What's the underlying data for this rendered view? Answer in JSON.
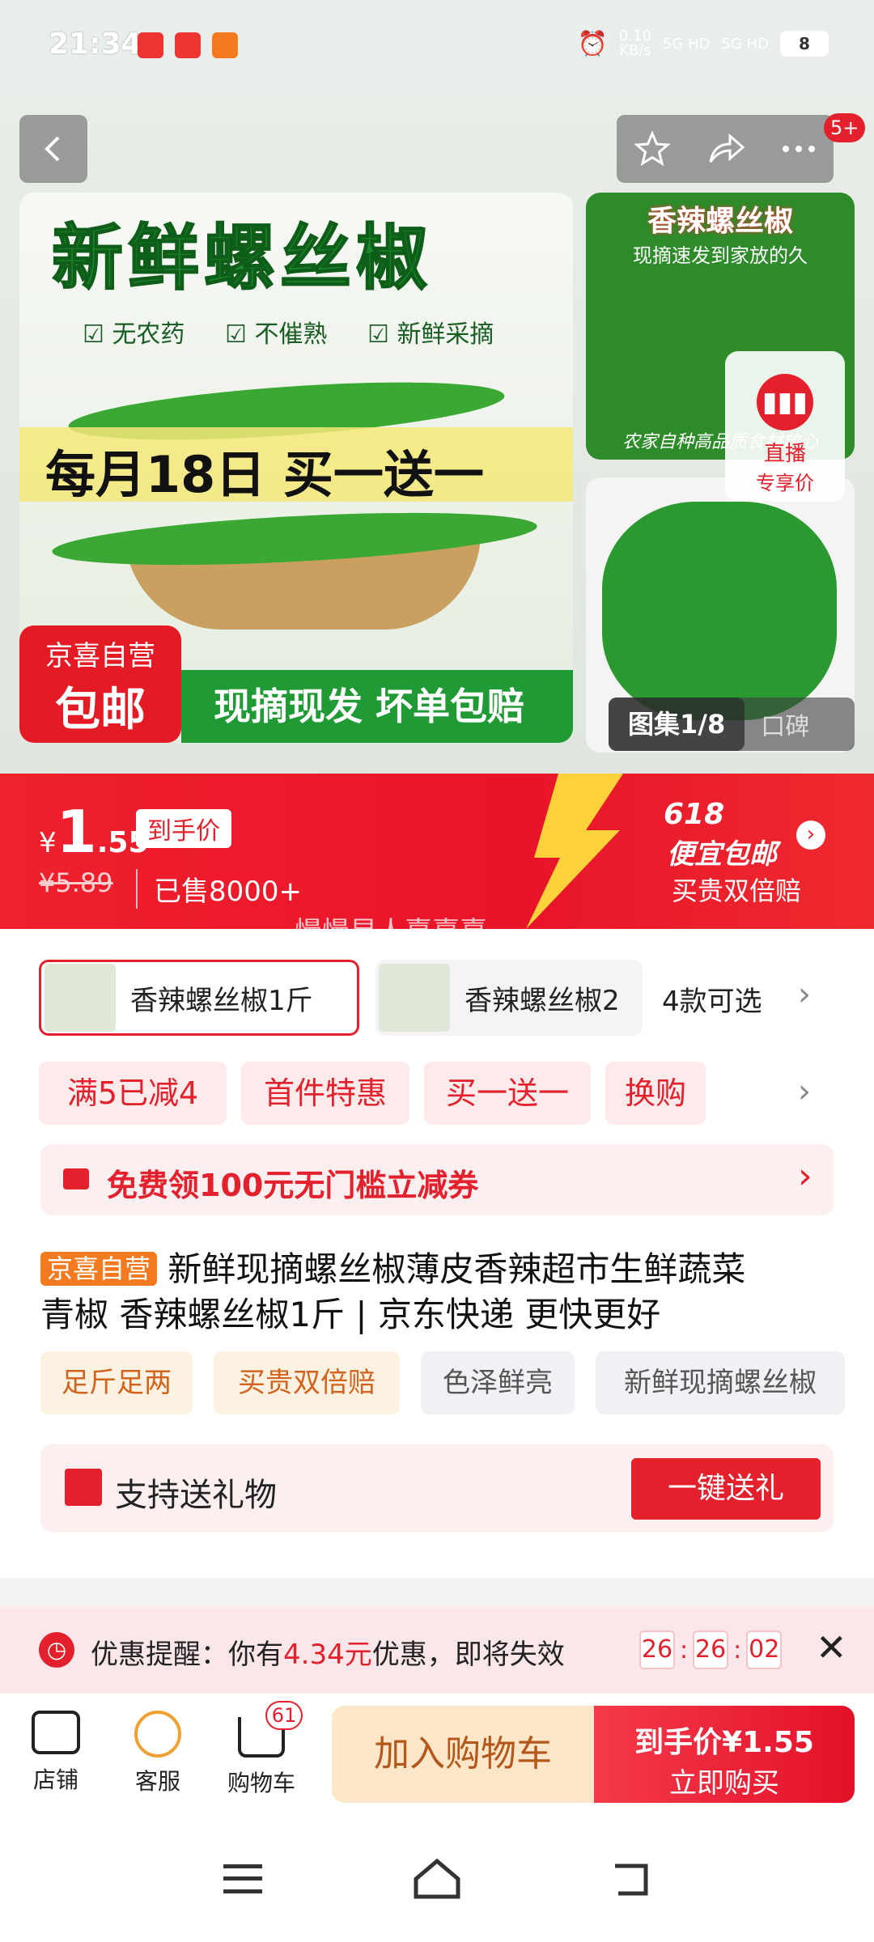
{
  "status": {
    "time": "21:34",
    "net_speed": "0.10",
    "net_unit": "KB/s",
    "sig1": "5G HD",
    "sig2": "5G HD",
    "battery": "8"
  },
  "toolbar": {
    "badge": "5+"
  },
  "gallery": {
    "main_title": "新鲜螺丝椒",
    "checks": [
      "无农药",
      "不催熟",
      "新鲜采摘"
    ],
    "promo": "每月18日 买一送一",
    "badge_top": "京喜自营",
    "badge_bottom": "包邮",
    "green_bar": "现摘现发  坏单包赔",
    "thumb1_title": "香辣螺丝椒",
    "thumb1_sub": "现摘速发到家放的久",
    "thumb1_caption": "农家自种高品质食材放心",
    "live_label": "直播",
    "live_sub": "专享价",
    "counter": "图集1/8",
    "reviews": "口碑"
  },
  "price": {
    "currency": "¥",
    "int": "1",
    "dec": ".55",
    "tag": "到手价",
    "orig": "¥5.89",
    "sold": "已售8000+",
    "event_num": "618",
    "event_title": "便宜包邮",
    "event_sub": "买贵双倍赔",
    "watermark": "慢慢星人熹熹熹"
  },
  "sku": {
    "opt1": "香辣螺丝椒1斤",
    "opt2": "香辣螺丝椒2",
    "more": "4款可选"
  },
  "tags": [
    "满5已减4",
    "首件特惠",
    "买一送一",
    "换购"
  ],
  "coupon": {
    "text": "免费领100元无门槛立减券"
  },
  "title": {
    "badge": "京喜自营",
    "line1": "新鲜现摘螺丝椒薄皮香辣超市生鲜蔬菜",
    "line2": "青椒 香辣螺丝椒1斤 | 京东快递 更快更好"
  },
  "features": [
    "足斤足两",
    "买贵双倍赔",
    "色泽鲜亮",
    "新鲜现摘螺丝椒"
  ],
  "gift": {
    "text": "支持送礼物",
    "btn": "一键送礼"
  },
  "remind": {
    "pre": "优惠提醒：你有",
    "amount": "4.34元",
    "post": "优惠，即将失效",
    "h": "26",
    "m": "26",
    "s": "02"
  },
  "bottom": {
    "shop": "店铺",
    "service": "客服",
    "cart": "购物车",
    "cart_count": "61",
    "add_cart": "加入购物车",
    "buy_price": "到手价¥1.55",
    "buy_now": "立即购买"
  },
  "colors": {
    "brand_red": "#e4202c",
    "green": "#1f9a34"
  }
}
